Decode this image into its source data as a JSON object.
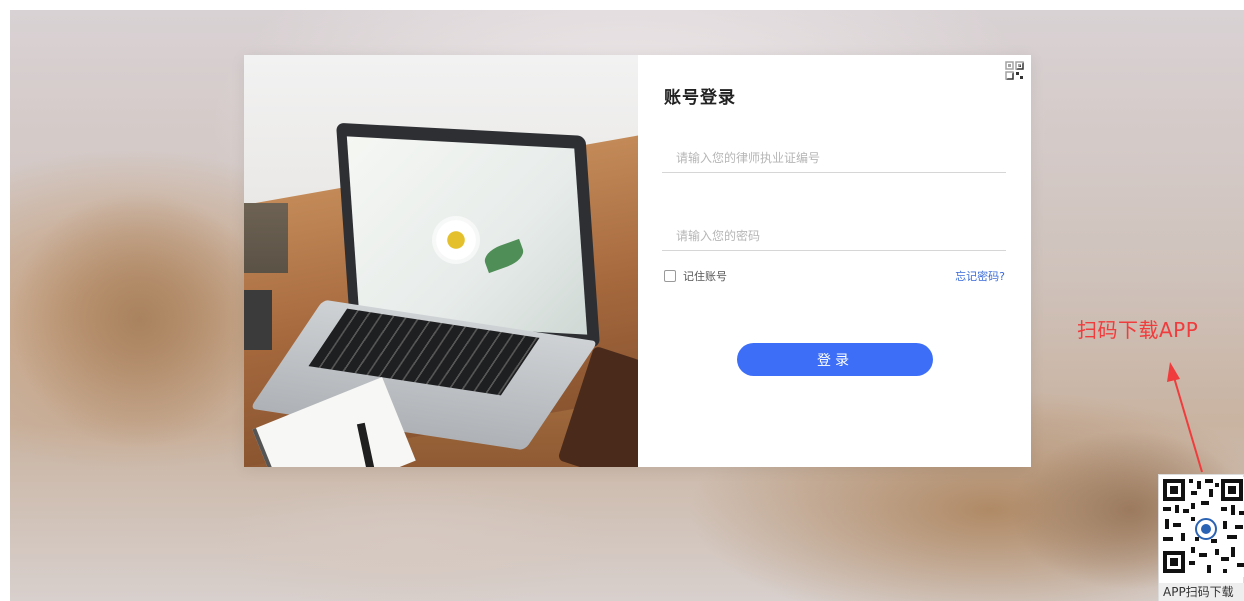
{
  "login": {
    "title": "账号登录",
    "license_placeholder": "请输入您的律师执业证编号",
    "password_placeholder": "请输入您的密码",
    "remember_label": "记住账号",
    "forgot_label": "忘记密码?",
    "submit_label": "登录"
  },
  "app_download": {
    "callout": "扫码下载APP",
    "qr_caption": "APP扫码下载"
  },
  "colors": {
    "accent": "#3d6ef8",
    "link": "#3a6bd9",
    "callout": "#f03c3c"
  },
  "icons": {
    "corner": "qr-code-icon",
    "arrow": "red-arrow-up-icon"
  }
}
